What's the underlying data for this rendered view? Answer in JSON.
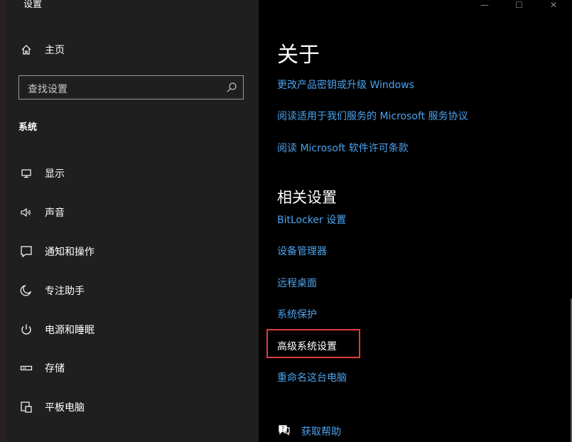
{
  "window": {
    "title": "设置"
  },
  "sidebar": {
    "home_label": "主页",
    "search_placeholder": "查找设置",
    "section": "系统",
    "items": [
      {
        "label": "显示",
        "icon": "display-icon"
      },
      {
        "label": "声音",
        "icon": "sound-icon"
      },
      {
        "label": "通知和操作",
        "icon": "notification-icon"
      },
      {
        "label": "专注助手",
        "icon": "focus-assist-icon"
      },
      {
        "label": "电源和睡眠",
        "icon": "power-icon"
      },
      {
        "label": "存储",
        "icon": "storage-icon"
      },
      {
        "label": "平板电脑",
        "icon": "tablet-icon"
      },
      {
        "label": "",
        "icon": "multitasking-icon"
      }
    ]
  },
  "main": {
    "about_heading": "关于",
    "about_links": [
      "更改产品密钥或升级 Windows",
      "阅读适用于我们服务的 Microsoft 服务协议",
      "阅读 Microsoft 软件许可条款"
    ],
    "related_heading": "相关设置",
    "related_links": [
      "BitLocker 设置",
      "设备管理器",
      "远程桌面",
      "系统保护",
      "高级系统设置",
      "重命名这台电脑"
    ],
    "help_label": "获取帮助"
  },
  "window_controls": {
    "minimize": "—",
    "maximize": "☐",
    "close": "✕"
  },
  "colors": {
    "link": "#4aa3f0",
    "sidebar_bg": "#1f1f1f",
    "main_bg": "#000000",
    "highlight": "#e03c3c"
  }
}
